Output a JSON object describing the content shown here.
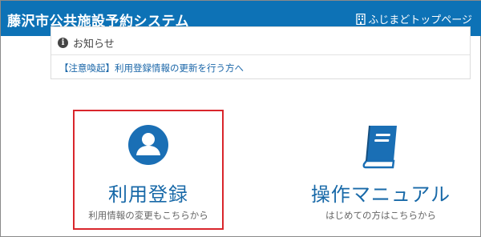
{
  "header": {
    "title": "藤沢市公共施設予約システム",
    "top_link_icon": "building-icon",
    "top_link_label": "ふじまどトップページ"
  },
  "notice": {
    "icon": "info-icon",
    "icon_glyph": "i",
    "title": "お知らせ",
    "link_text": "【注意喚起】利用登録情報の更新を行う方へ"
  },
  "cards": {
    "register": {
      "icon": "user-icon",
      "label": "利用登録",
      "subtext": "利用情報の変更もこちらから",
      "highlight_color": "#d9262c"
    },
    "manual": {
      "icon": "book-icon",
      "label": "操作マニュアル",
      "subtext": "はじめての方はこちらから"
    }
  },
  "colors": {
    "header_bg": "#0d72b6",
    "accent": "#1869a8",
    "icon_blue": "#1a6fb5"
  }
}
